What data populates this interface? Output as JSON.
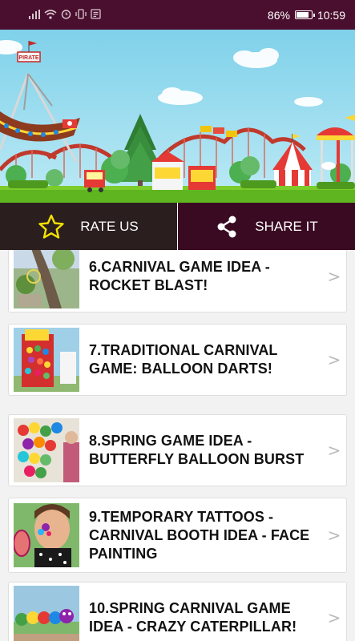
{
  "status_bar": {
    "battery_percent": "86%",
    "battery_level": 0.86,
    "time": "10:59",
    "icons": [
      "signal-icon",
      "wifi-icon",
      "alarm-icon",
      "vibrate-icon",
      "notification-icon"
    ]
  },
  "banner": {
    "sign_text": "PIRATE",
    "sky_color": "#8fd6ec",
    "grass_color": "#7ccc2c"
  },
  "actions": {
    "rate_label": "RATE US",
    "share_label": "SHARE IT",
    "rate_icon": "star-icon",
    "share_icon": "share-icon"
  },
  "list": {
    "items": [
      {
        "title": "6.CARNIVAL GAME IDEA - ROCKET BLAST!",
        "thumb": "rocket-blast-thumbnail"
      },
      {
        "title": "7.TRADITIONAL CARNIVAL GAME: BALLOON DARTS!",
        "thumb": "balloon-darts-thumbnail"
      },
      {
        "title": "8.SPRING GAME IDEA - BUTTERFLY BALLOON BURST",
        "thumb": "butterfly-balloon-thumbnail"
      },
      {
        "title": "9.TEMPORARY TATTOOS - CARNIVAL BOOTH IDEA - FACE PAINTING",
        "thumb": "face-painting-thumbnail"
      },
      {
        "title": "10.SPRING CARNIVAL GAME IDEA - CRAZY CATERPILLAR!",
        "thumb": "caterpillar-thumbnail"
      }
    ],
    "chevron": ">"
  }
}
